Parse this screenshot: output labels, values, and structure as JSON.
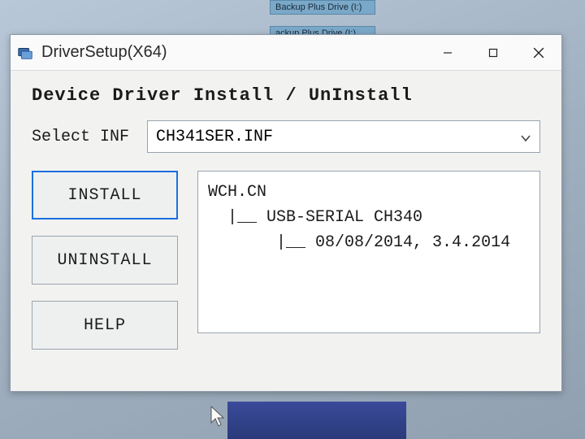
{
  "desktop": {
    "icon1": "Backup Plus Drive (I:)",
    "icon2": "ackup Plus Drive (I:)"
  },
  "window": {
    "title": "DriverSetup(X64)"
  },
  "content": {
    "heading": "Device Driver Install / UnInstall",
    "select_label": "Select INF",
    "inf_value": "CH341SER.INF",
    "buttons": {
      "install": "INSTALL",
      "uninstall": "UNINSTALL",
      "help": "HELP"
    },
    "driver_info": {
      "vendor": "WCH.CN",
      "device": "USB-SERIAL CH340",
      "version": "08/08/2014, 3.4.2014"
    }
  }
}
